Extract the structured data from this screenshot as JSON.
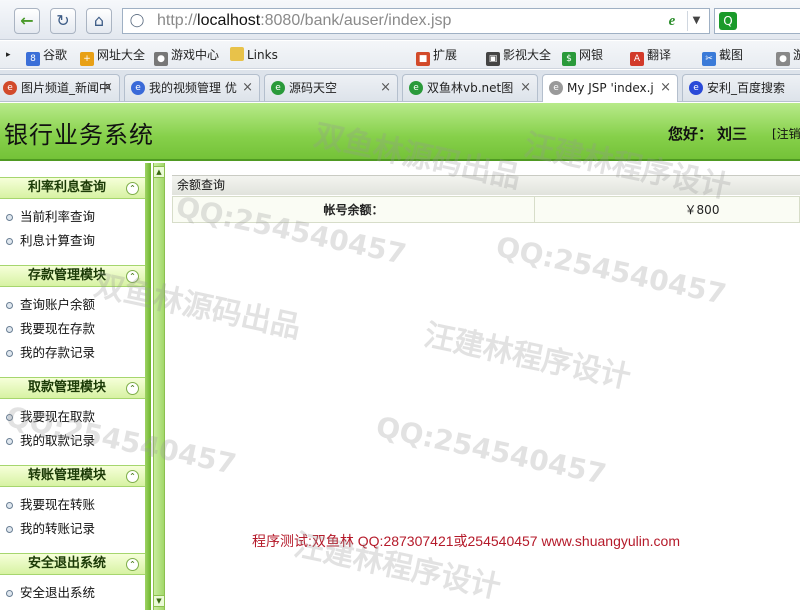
{
  "browser": {
    "url_prefix": "http://",
    "url_host": "localhost",
    "url_rest": ":8080/bank/auser/index.jsp",
    "bookmarks": [
      {
        "label": "谷歌",
        "icon": "google-icon",
        "color": "#3b6fd8"
      },
      {
        "label": "网址大全",
        "icon": "star-icon",
        "color": "#e8a016"
      },
      {
        "label": "游戏中心",
        "icon": "gamepad-icon",
        "color": "#777777"
      },
      {
        "label": "Links",
        "icon": "folder-icon",
        "color": "#e8c24a"
      },
      {
        "label": "扩展",
        "icon": "puzzle-icon",
        "color": "#d24a2a"
      },
      {
        "label": "影视大全",
        "icon": "film-icon",
        "color": "#444444"
      },
      {
        "label": "网银",
        "icon": "bank-icon",
        "color": "#2a9a3a"
      },
      {
        "label": "翻译",
        "icon": "translate-icon",
        "color": "#d23a2a"
      },
      {
        "label": "截图",
        "icon": "scissors-icon",
        "color": "#3a7ad8"
      },
      {
        "label": "游",
        "icon": "game-icon",
        "color": "#888888"
      }
    ],
    "tabs": [
      {
        "label": "图片频道_新闻中",
        "color": "#d24a2a"
      },
      {
        "label": "我的视频管理 优",
        "color": "#3a6ad8"
      },
      {
        "label": "源码天空",
        "color": "#2a9a3a"
      },
      {
        "label": "双鱼林vb.net图",
        "color": "#2a9a3a"
      },
      {
        "label": "My JSP 'index.j",
        "color": "#9a9a9a"
      },
      {
        "label": "安利_百度搜索",
        "color": "#2a4ad8"
      }
    ]
  },
  "app": {
    "title": "银行业务系统",
    "greeting": "您好：",
    "user": "刘三",
    "logout": "[注销"
  },
  "sidebar": {
    "sections": [
      {
        "title": "利率利息查询",
        "items": [
          "当前利率查询",
          "利息计算查询"
        ]
      },
      {
        "title": "存款管理模块",
        "items": [
          "查询账户余额",
          "我要现在存款",
          "我的存款记录"
        ]
      },
      {
        "title": "取款管理模块",
        "items": [
          "我要现在取款",
          "我的取款记录"
        ]
      },
      {
        "title": "转账管理模块",
        "items": [
          "我要现在转账",
          "我的转账记录"
        ]
      },
      {
        "title": "安全退出系统",
        "items": [
          "安全退出系统"
        ]
      }
    ]
  },
  "main": {
    "panel_title": "余额查询",
    "balance_label": "帐号余额：",
    "balance_value": "￥800"
  },
  "footer": {
    "credit": "程序测试:双鱼林 QQ:287307421或254540457 www.shuangyulin.com"
  },
  "watermark": {
    "cn1": "双鱼林源码出品",
    "cn2": "汪建林程序设计",
    "qq": "QQ:254540457"
  },
  "colors": {
    "header_green": "#86d04a",
    "credit_red": "#b51a2a"
  }
}
